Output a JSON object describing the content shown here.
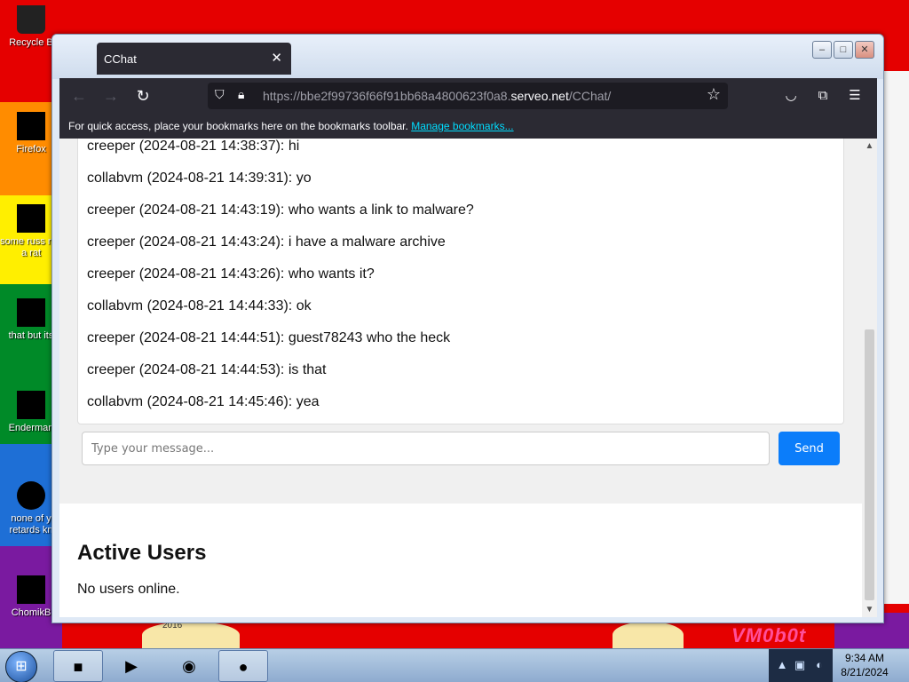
{
  "desktop": {
    "icons": [
      {
        "label": "Recycle B"
      },
      {
        "label": "Firefox"
      },
      {
        "label": "some russ ran a rat"
      },
      {
        "label": "that but its"
      },
      {
        "label": "Enderman"
      },
      {
        "label": "none of y retards kn"
      },
      {
        "label": "ChomikB"
      }
    ],
    "wallpaper_text": "VM0b0t",
    "small_text": "2016"
  },
  "window": {
    "tab_title": "CChat",
    "url_prefix": "https://bbe2f99736f66f91bb68a4800623f0a8.",
    "url_domain": "serveo.net",
    "url_path": "/CChat/",
    "bookmarks_text": "For quick access, place your bookmarks here on the bookmarks toolbar.",
    "bookmarks_link": "Manage bookmarks..."
  },
  "chat": {
    "messages": [
      "creeper (2024-08-21 14:38:37): hi",
      "collabvm (2024-08-21 14:39:31): yo",
      "creeper (2024-08-21 14:43:19): who wants a link to malware?",
      "creeper (2024-08-21 14:43:24): i have a malware archive",
      "creeper (2024-08-21 14:43:26): who wants it?",
      "collabvm (2024-08-21 14:44:33): ok",
      "creeper (2024-08-21 14:44:51): guest78243 who the heck",
      "creeper (2024-08-21 14:44:53): is that",
      "collabvm (2024-08-21 14:45:46): yea"
    ],
    "input_placeholder": "Type your message...",
    "send_label": "Send"
  },
  "users": {
    "heading": "Active Users",
    "status": "No users online."
  },
  "taskbar": {
    "time": "9:34 AM",
    "date": "8/21/2024"
  },
  "colors": {
    "send_button": "#0b7dfa",
    "browser_chrome": "#2b2a33"
  }
}
